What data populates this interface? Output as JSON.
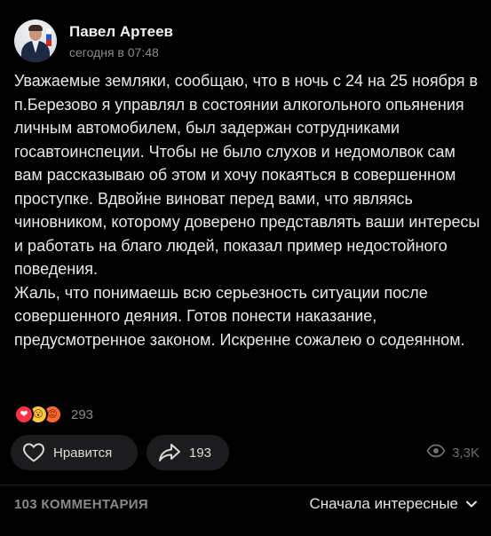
{
  "post": {
    "author": "Павел Артеев",
    "time": "сегодня в 07:48",
    "paragraphs": [
      "Уважаемые земляки, сообщаю, что в ночь с 24 на 25 ноября в п.Березово я управлял в состоянии алкогольного опьянения личным автомобилем, был задержан сотрудниками госавтоинспеции. Чтобы не было слухов и недомолвок сам вам рассказываю об этом и хочу покаяться в совершенном проступке. Вдвойне виноват перед вами, что являясь чиновником, которому доверено представлять ваши интересы и работать на благо людей, показал пример недостойного поведения.",
      "Жаль, что понимаешь всю серьезность ситуации после совершенного деяния. Готов понести наказание, предусмотренное законом. Искренне сожалею о содеянном."
    ]
  },
  "reactions": {
    "icons": [
      "heart-icon",
      "wow-face-icon",
      "angry-face-icon"
    ],
    "count": "293"
  },
  "actions": {
    "like_label": "Нравится",
    "share_count": "193",
    "views": "3,3K"
  },
  "comments": {
    "count_label": "103 КОММЕНТАРИЯ",
    "sort_label": "Сначала интересные"
  },
  "colors": {
    "background": "#000000",
    "pill": "#1c1c1e",
    "muted_text": "#8a8a8e",
    "heart": "#ff3347"
  }
}
